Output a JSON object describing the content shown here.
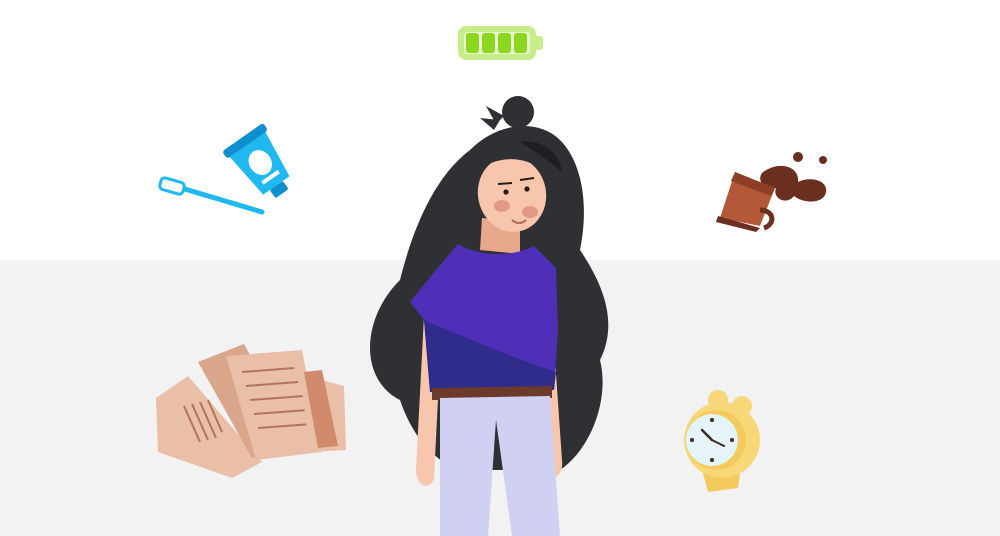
{
  "scene": {
    "battery_level": 1.0,
    "colors": {
      "background": "#ffffff",
      "floor": "#f2f2f2",
      "battery": "#8dd61f",
      "battery_shell": "#c9ec8a",
      "hair": "#2f3034",
      "skin": "#f7c6ad",
      "shirt": "#4f2fb8",
      "shirt_shadow": "#2f2c8c",
      "pants": "#cfd0f2",
      "toothbrush": "#1fb8ef",
      "coffee": "#6b2f1f",
      "mug": "#b4583a",
      "paper": "#e9bfa8",
      "clock": "#f7d778"
    },
    "icons": [
      "battery-icon",
      "toothbrush-icon",
      "toothpaste-icon",
      "spilled-coffee-icon",
      "papers-icon",
      "alarm-clock-icon",
      "tired-girl-illustration"
    ]
  }
}
